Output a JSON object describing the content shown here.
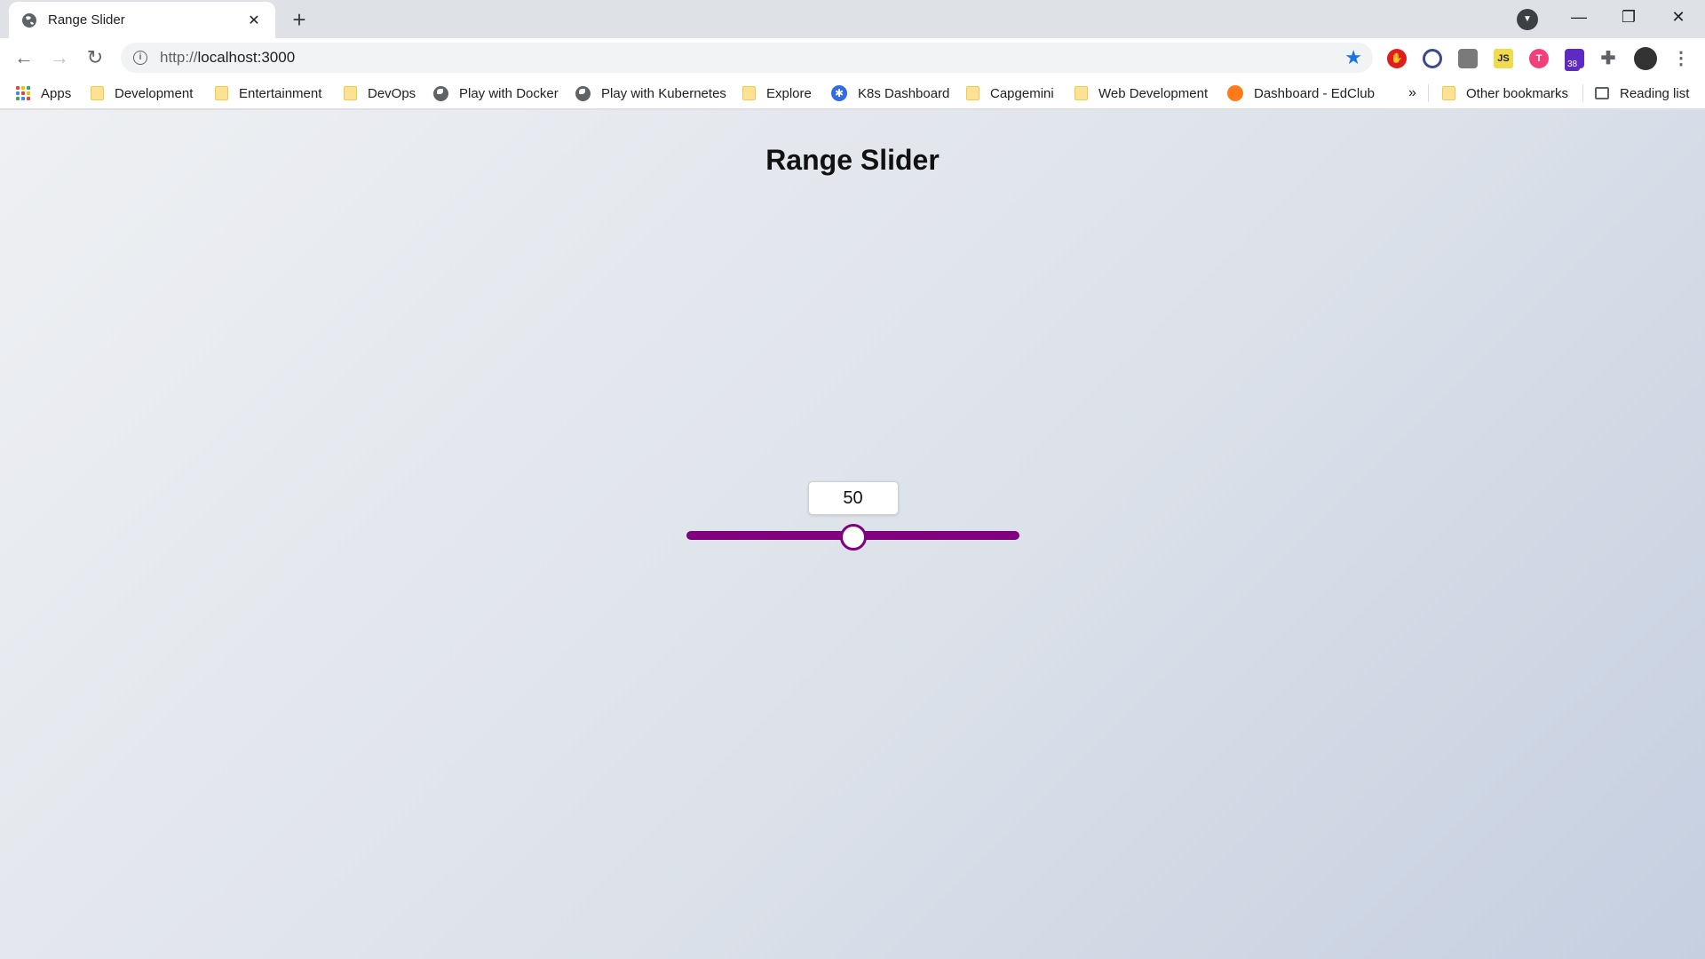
{
  "browser": {
    "tab_title": "Range Slider",
    "tab_close": "✕",
    "new_tab": "+",
    "url_protocol": "http://",
    "url_host": "localhost:3000",
    "bookmarks": [
      {
        "label": "Apps",
        "icon": "apps-icon"
      },
      {
        "label": "Development",
        "icon": "folder-icon"
      },
      {
        "label": "Entertainment",
        "icon": "folder-icon"
      },
      {
        "label": "DevOps",
        "icon": "folder-icon"
      },
      {
        "label": "Play with Docker",
        "icon": "globe-icon"
      },
      {
        "label": "Play with Kubernetes",
        "icon": "globe-icon"
      },
      {
        "label": "Explore",
        "icon": "folder-icon"
      },
      {
        "label": "K8s Dashboard",
        "icon": "k8s-icon"
      },
      {
        "label": "Capgemini",
        "icon": "folder-icon"
      },
      {
        "label": "Web Development",
        "icon": "folder-icon"
      },
      {
        "label": "Dashboard - EdClub",
        "icon": "fox-icon"
      }
    ],
    "bookmarks_overflow": "»",
    "other_bookmarks": "Other bookmarks",
    "reading_list": "Reading list",
    "extension_badge": "38",
    "extension_js_label": "JS"
  },
  "page": {
    "title": "Range Slider",
    "slider": {
      "value": "50",
      "min": 0,
      "max": 100,
      "track_color": "#800080",
      "thumb_border_color": "#800080"
    }
  }
}
